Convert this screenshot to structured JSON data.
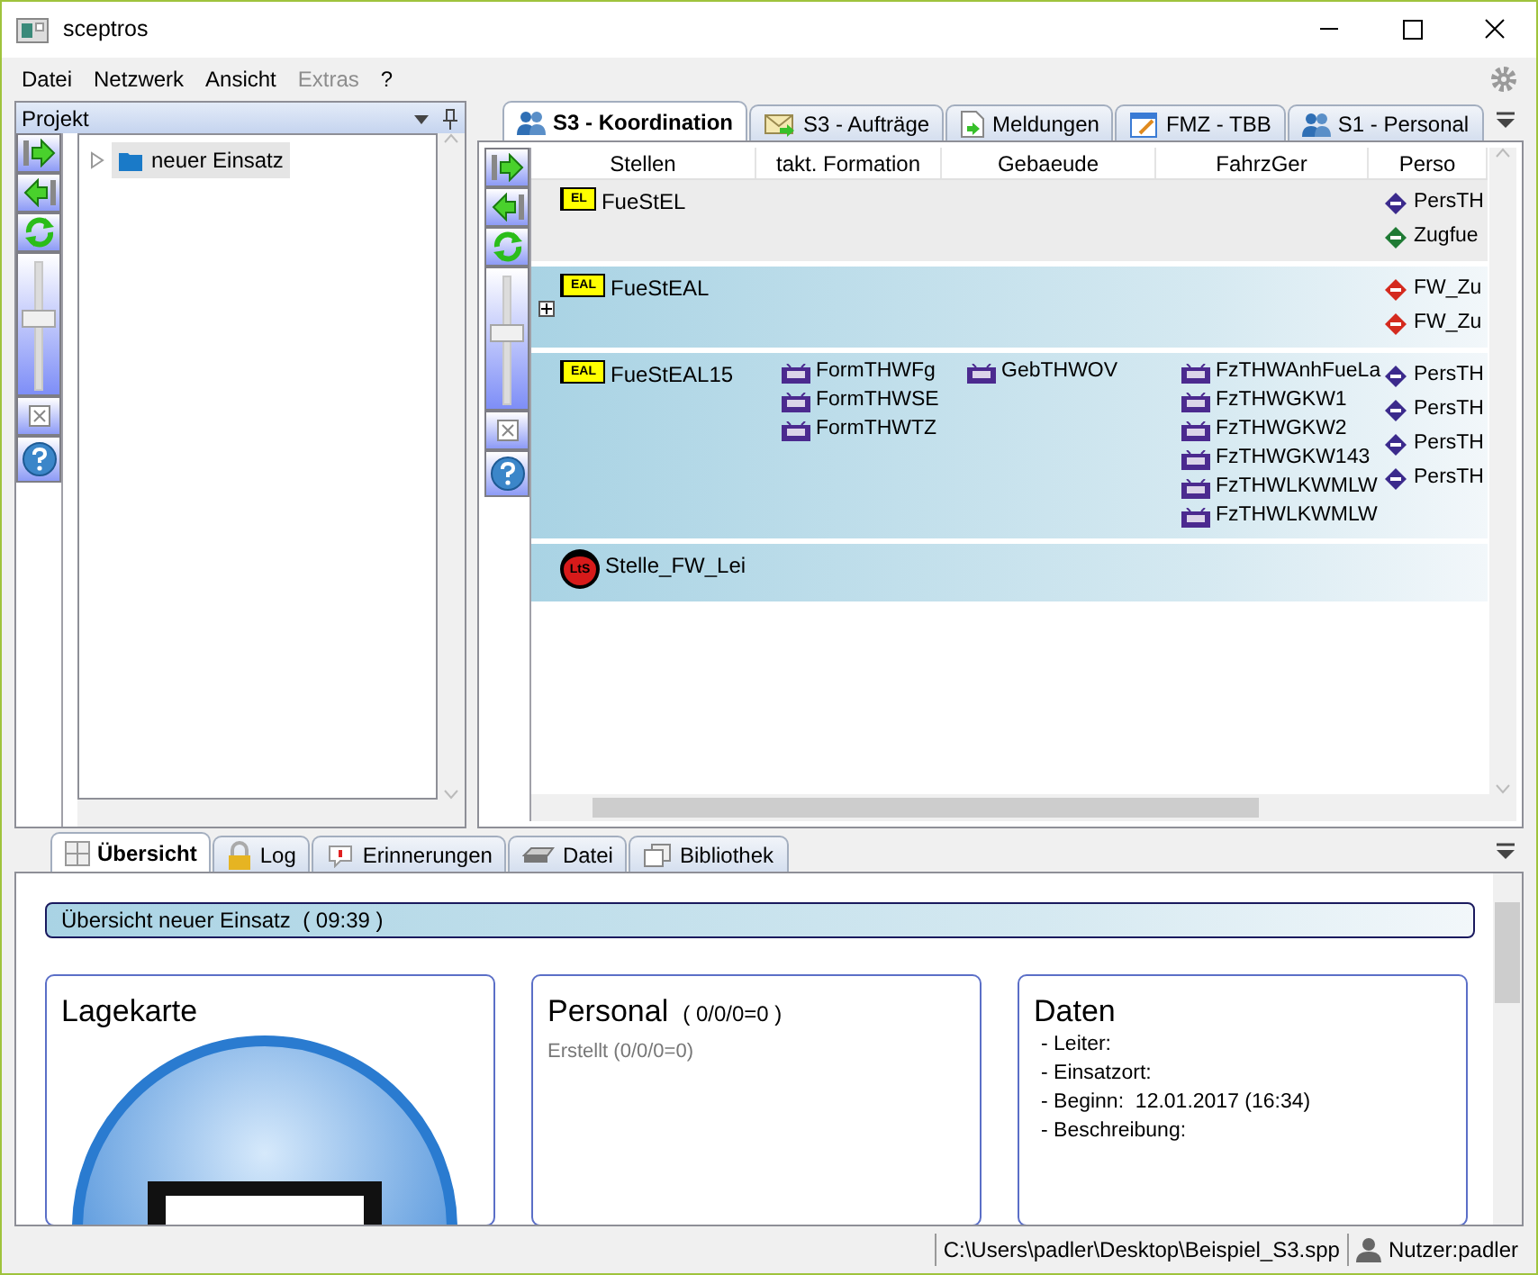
{
  "window": {
    "title": "sceptros"
  },
  "menu": [
    {
      "label": "Datei",
      "disabled": false
    },
    {
      "label": "Netzwerk",
      "disabled": false
    },
    {
      "label": "Ansicht",
      "disabled": false
    },
    {
      "label": "Extras",
      "disabled": true
    },
    {
      "label": "?",
      "disabled": false
    }
  ],
  "project_panel": {
    "title": "Projekt",
    "toolbar": {
      "level": 0.55
    },
    "tree": [
      {
        "label": "neuer Einsatz",
        "selected": true,
        "expanded": false
      }
    ]
  },
  "tabs": [
    {
      "label": "S3 - Koordination",
      "kind": "people",
      "selected": true
    },
    {
      "label": "S3 - Aufträge",
      "kind": "mail",
      "selected": false
    },
    {
      "label": "Meldungen",
      "kind": "document",
      "selected": false
    },
    {
      "label": "FMZ - TBB",
      "kind": "notepad",
      "selected": false
    },
    {
      "label": "S1 - Personal",
      "kind": "people",
      "selected": false
    }
  ],
  "board": {
    "toolbar": {
      "level": 0.55
    },
    "columns": [
      "Stellen",
      "takt. Formation",
      "Gebaeude",
      "FahrzGer",
      "Perso"
    ],
    "rows": [
      {
        "kind": "plain",
        "collapsed": false,
        "stelle": {
          "label": "FueStEL",
          "badge": "EL",
          "kind": "flag"
        },
        "personal": [
          {
            "label": "PersTH",
            "color": "#3b2a8c"
          },
          {
            "label": "Zugfue",
            "color": "#1f7a34"
          }
        ]
      },
      {
        "kind": "band",
        "collapsed": true,
        "stelle": {
          "label": "FueStEAL",
          "badge": "EAL",
          "kind": "flag"
        },
        "personal": [
          {
            "label": "FW_Zu",
            "color": "#d42a1e"
          },
          {
            "label": "FW_Zu",
            "color": "#d42a1e"
          }
        ]
      },
      {
        "kind": "band",
        "collapsed": false,
        "stelle": {
          "label": "FueStEAL15",
          "badge": "EAL",
          "kind": "flag"
        },
        "formation": [
          "FormTHWFg",
          "FormTHWSE",
          "FormTHWTZ"
        ],
        "gebaeude": [
          "GebTHWOV"
        ],
        "fahrzeuge": [
          "FzTHWAnhFueLa",
          "FzTHWGKW1",
          "FzTHWGKW2",
          "FzTHWGKW143",
          "FzTHWLKWMLW",
          "FzTHWLKWMLW"
        ],
        "personal": [
          {
            "label": "PersTH",
            "color": "#3b2a8c"
          },
          {
            "label": "PersTH",
            "color": "#3b2a8c"
          },
          {
            "label": "PersTH",
            "color": "#3b2a8c"
          },
          {
            "label": "PersTH",
            "color": "#3b2a8c"
          }
        ]
      },
      {
        "kind": "band",
        "collapsed": false,
        "stelle": {
          "label": "Stelle_FW_Lei",
          "badge": "LtS",
          "kind": "circle"
        }
      }
    ]
  },
  "bottom_tabs": [
    {
      "label": "Übersicht",
      "kind": "grid",
      "selected": true
    },
    {
      "label": "Log",
      "kind": "lock",
      "selected": false
    },
    {
      "label": "Erinnerungen",
      "kind": "bubble",
      "selected": false
    },
    {
      "label": "Datei",
      "kind": "drive",
      "selected": false
    },
    {
      "label": "Bibliothek",
      "kind": "windows",
      "selected": false
    }
  ],
  "overview": {
    "header": "Übersicht neuer Einsatz  ( 09:39 )",
    "map_card": {
      "title": "Lagekarte"
    },
    "personal_card": {
      "title": "Personal",
      "count": "( 0/0/0=0 )",
      "created": "Erstellt (0/0/0=0)"
    },
    "data_card": {
      "title": "Daten",
      "lines": [
        "- Leiter:",
        "- Einsatzort:",
        "- Beginn:  12.01.2017 (16:34)",
        "- Beschreibung:"
      ]
    }
  },
  "status_bar": {
    "path": "C:\\Users\\padler\\Desktop\\Beispiel_S3.spp",
    "user": "Nutzer:padler"
  }
}
